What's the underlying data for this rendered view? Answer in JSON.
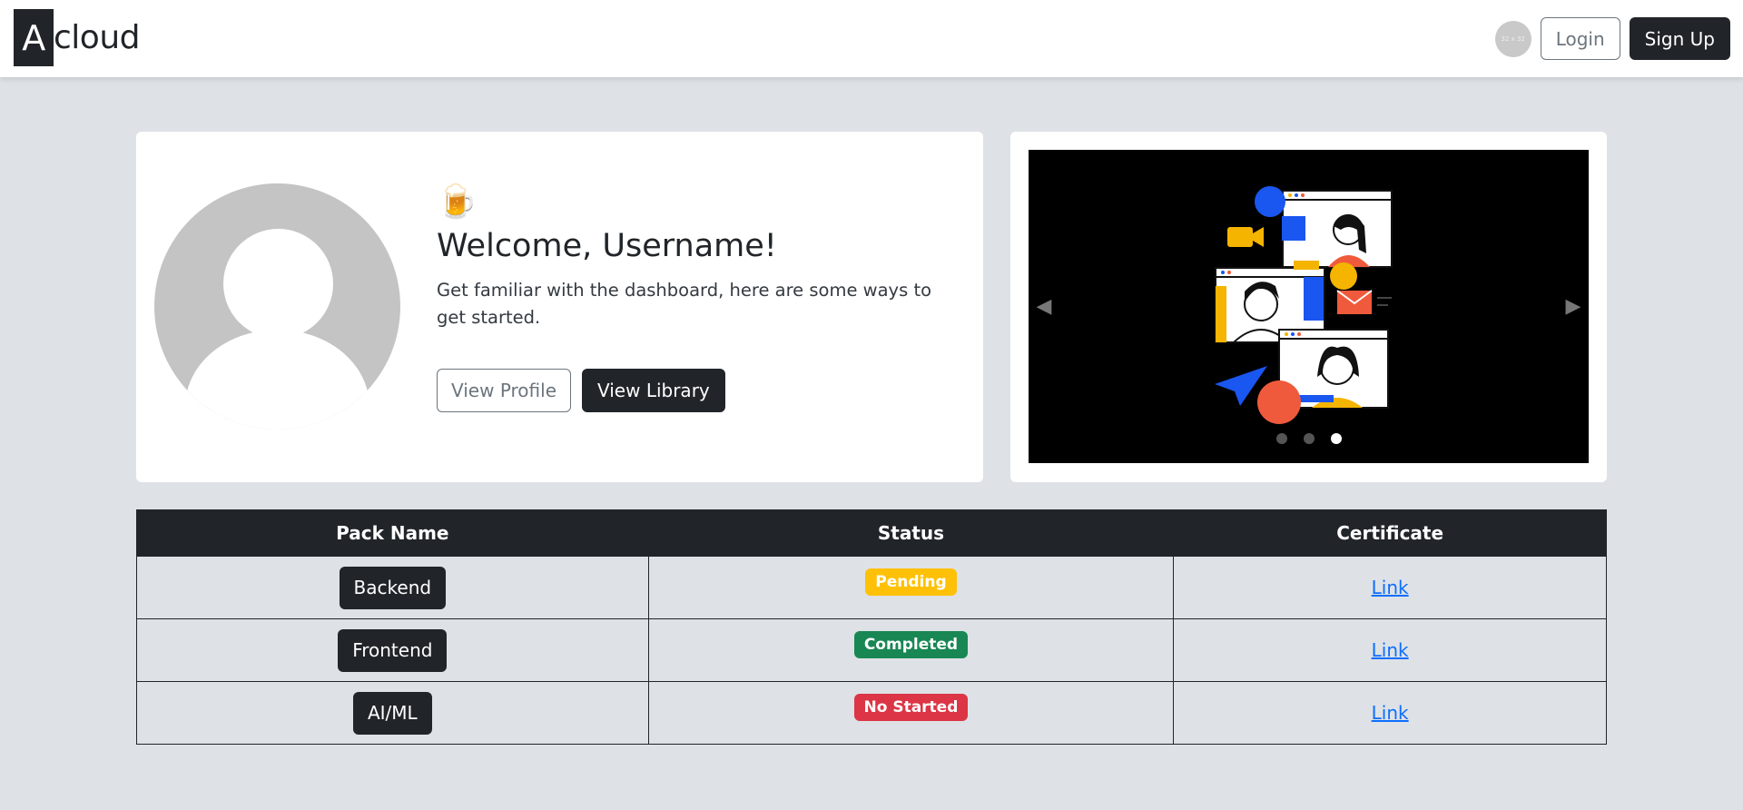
{
  "navbar": {
    "brand_letter": "A",
    "brand_rest": "cloud",
    "avatar_alt": "32 x 32",
    "login_label": "Login",
    "signup_label": "Sign Up"
  },
  "welcome": {
    "icon": "🍺",
    "title": "Welcome, Username!",
    "text": "Get familiar with the dashboard, here are some ways to get started.",
    "view_profile_label": "View Profile",
    "view_library_label": "View Library"
  },
  "carousel": {
    "prev_icon": "chevron-left-icon",
    "next_icon": "chevron-right-icon",
    "slide_count": 3,
    "active_slide": 3
  },
  "table": {
    "headers": [
      "Pack Name",
      "Status",
      "Certificate"
    ],
    "rows": [
      {
        "pack": "Backend",
        "status": "Pending",
        "status_color": "#ffc107",
        "cert": "Link"
      },
      {
        "pack": "Frontend",
        "status": "Completed",
        "status_color": "#198754",
        "cert": "Link"
      },
      {
        "pack": "AI/ML",
        "status": "No Started",
        "status_color": "#dc3545",
        "cert": "Link"
      }
    ]
  },
  "colors": {
    "dark": "#212529",
    "background": "#dee2e6",
    "link": "#0d6efd"
  }
}
